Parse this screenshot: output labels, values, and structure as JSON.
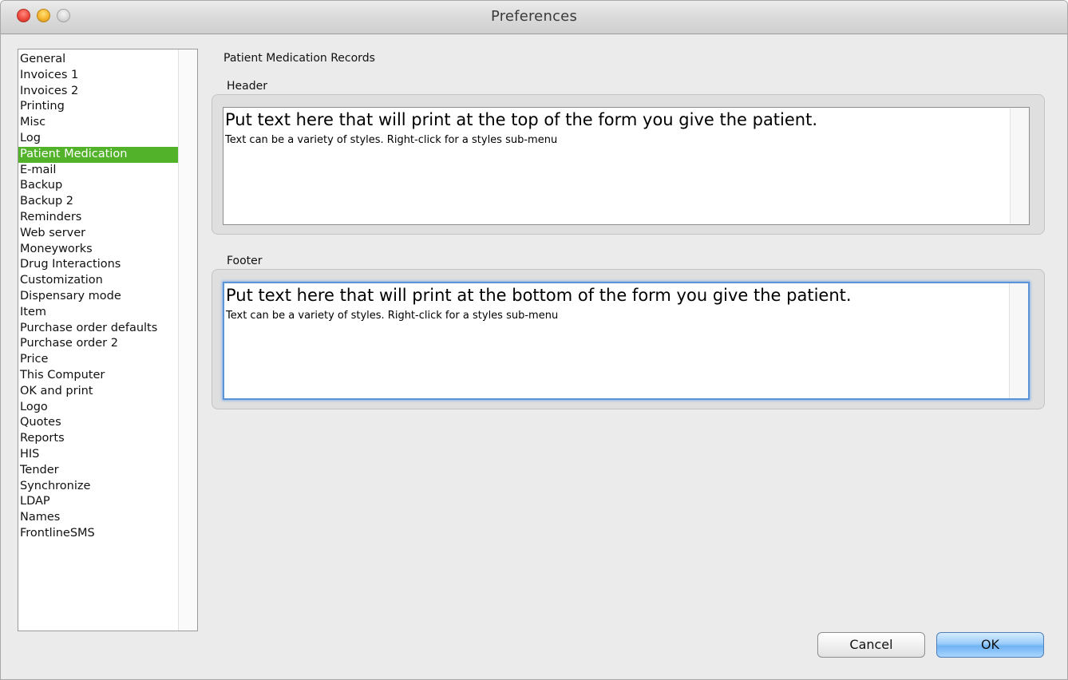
{
  "window": {
    "title": "Preferences"
  },
  "sidebar": {
    "selected": "Patient Medication",
    "items": [
      "General",
      "Invoices 1",
      "Invoices 2",
      "Printing",
      "Misc",
      "Log",
      "Patient Medication",
      "E-mail",
      "Backup",
      "Backup 2",
      "Reminders",
      "Web server",
      "Moneyworks",
      "Drug Interactions",
      "Customization",
      "Dispensary mode",
      "Item",
      "Purchase order defaults",
      "Purchase order 2",
      "Price",
      "This Computer",
      "OK and print",
      "Logo",
      "Quotes",
      "Reports",
      "HIS",
      "Tender",
      "Synchronize",
      "LDAP",
      "Names",
      "FrontlineSMS"
    ]
  },
  "panel": {
    "section_title": "Patient Medication Records",
    "header": {
      "label": "Header",
      "line1": "Put text here that will print at the top of the form you give the patient.",
      "line2": "Text can be a variety of styles. Right-click for a styles sub-menu"
    },
    "footer": {
      "label": "Footer",
      "line1": "Put text here that will print at the bottom of the form you give the patient.",
      "line2": "Text can be a variety of styles. Right-click for a styles sub-menu"
    }
  },
  "buttons": {
    "cancel": "Cancel",
    "ok": "OK"
  },
  "colors": {
    "selection": "#52b32b",
    "focus_ring": "#5b93d8",
    "default_button": "#6fb3f3"
  }
}
